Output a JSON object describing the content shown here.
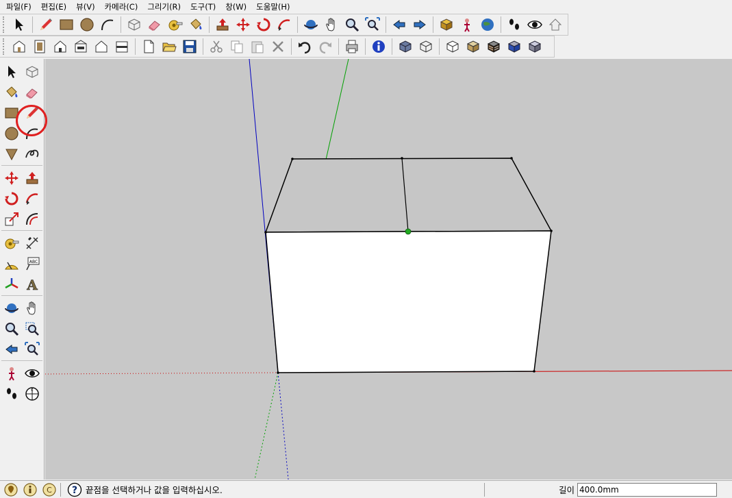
{
  "menu": [
    "파일(F)",
    "편집(E)",
    "뷰(V)",
    "카메라(C)",
    "그리기(R)",
    "도구(T)",
    "창(W)",
    "도움말(H)"
  ],
  "toolbar_row1": [
    "select-arrow-icon",
    "sep",
    "pencil-line-icon",
    "rectangle-icon",
    "circle-icon",
    "arc-icon",
    "sep",
    "make-component-icon",
    "eraser-icon",
    "tape-measure-icon",
    "paint-bucket-icon",
    "sep",
    "push-pull-icon",
    "move-icon",
    "rotate-icon",
    "follow-me-icon",
    "sep",
    "orbit-icon",
    "pan-hand-icon",
    "zoom-icon",
    "zoom-extents-icon",
    "sep",
    "previous-view-icon",
    "next-view-icon",
    "sep",
    "get-models-icon",
    "position-camera-icon",
    "google-earth-icon",
    "sep",
    "walk-icon",
    "look-around-icon",
    "share-model-icon"
  ],
  "toolbar_row2": [
    "iso-view-icon",
    "top-view-icon",
    "front-view-icon",
    "right-view-icon",
    "back-view-icon",
    "left-view-icon",
    "sep",
    "new-file-icon",
    "open-file-icon",
    "save-file-icon",
    "sep",
    "cut-icon",
    "copy-icon",
    "paste-icon",
    "delete-icon",
    "sep",
    "undo-icon",
    "redo-icon",
    "sep",
    "print-icon",
    "sep",
    "info-icon",
    "sep",
    "xray-icon",
    "wireframe-icon",
    "sep",
    "hidden-line-icon",
    "shaded-icon",
    "shaded-texture-icon",
    "monochrome-icon",
    "xray-box-icon"
  ],
  "left_toolbar": [
    "select-arrow-icon",
    "make-component-icon",
    "paint-bucket-icon",
    "eraser-icon",
    "rectangle-icon",
    "pencil-line-icon",
    "circle-icon",
    "arc-icon",
    "polygon-icon",
    "freehand-icon",
    "sep",
    "move-icon",
    "push-pull-icon",
    "rotate-icon",
    "follow-me-icon",
    "scale-icon",
    "offset-icon",
    "sep",
    "tape-measure-icon",
    "dimension-icon",
    "protractor-icon",
    "text-label-icon",
    "axes-icon",
    "3d-text-icon",
    "sep",
    "orbit-icon",
    "pan-hand-icon",
    "zoom-icon",
    "zoom-window-icon",
    "previous-view-icon",
    "zoom-extents-icon",
    "sep",
    "position-camera-icon",
    "look-around-icon",
    "walk-icon",
    "section-plane-icon"
  ],
  "status": {
    "hint": "끝점을 선택하거나 값을 입력하십시오.",
    "vcb_label": "길이",
    "vcb_value": "400.0mm",
    "icons": [
      "geo-location-icon",
      "credits-icon",
      "user-icon",
      "help-icon"
    ]
  },
  "colors": {
    "viewport_bg": "#c8c8c8",
    "axis_red": "#cc0000",
    "axis_green": "#00a000",
    "axis_blue": "#0000c0",
    "face_front": "#ffffff",
    "face_top": "#c6c6c6",
    "edge": "#000000",
    "midpoint": "#22aa22",
    "highlight_ring": "#e02020"
  }
}
